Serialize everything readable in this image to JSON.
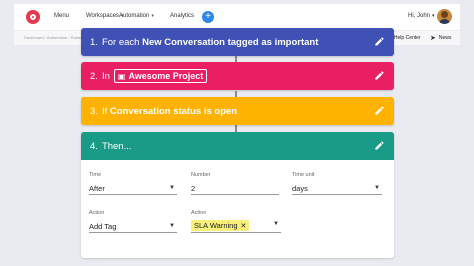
{
  "topbar": {
    "nav": [
      "Menu",
      "Workspaces",
      "Automation",
      "Analytics"
    ],
    "add_symbol": "+",
    "greeting": "Hi, John"
  },
  "subbar": {
    "breadcrumb": "Dashboard  ›  Automation  ›  Rules",
    "help_label": "Help Center",
    "news_label": "News"
  },
  "steps": [
    {
      "number": "1.",
      "text": "For each ",
      "bold": "New Conversation tagged as important",
      "color": "#3f51b5"
    },
    {
      "number": "2.",
      "text": "In",
      "chip": "Awesome Project",
      "color": "#e91e63"
    },
    {
      "number": "3.",
      "text": "If ",
      "bold": "Conversation status is open",
      "color": "#ffb300"
    },
    {
      "number": "4.",
      "text": "Then...",
      "color": "#1a9b87"
    }
  ],
  "then_form": {
    "time": {
      "label": "Time",
      "value": "After"
    },
    "number": {
      "label": "Number",
      "value": "2"
    },
    "time_unit": {
      "label": "Time unit",
      "value": "days"
    },
    "action1": {
      "label": "Action",
      "value": "Add Tag"
    },
    "action2": {
      "label": "Action",
      "chip": "SLA Warning"
    }
  },
  "icons": {
    "edit": "pencil-icon",
    "dropdown": "chevron-down-icon"
  }
}
